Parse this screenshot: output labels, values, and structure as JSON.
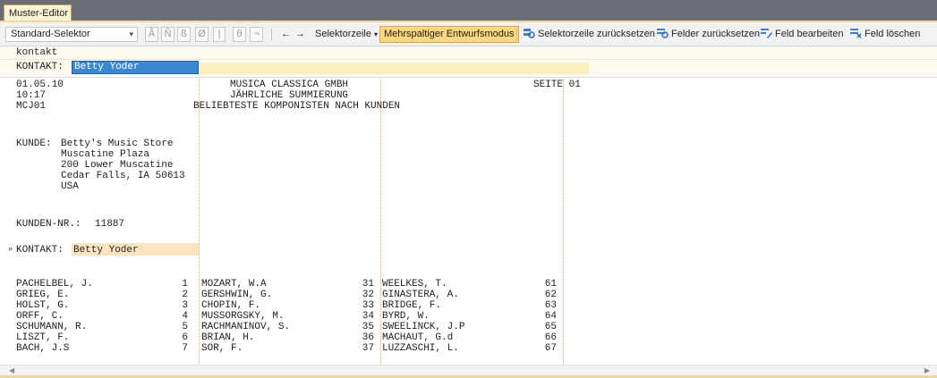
{
  "tab": {
    "title": "Muster-Editor"
  },
  "toolbar": {
    "selector": "Standard-Selektor",
    "glyphs": [
      "Ã",
      "Ñ",
      "ß",
      "Ø",
      "|",
      "θ",
      "¬"
    ],
    "arrow_left": "←",
    "arrow_right": "→",
    "selektorzeile_label": "Selektorzeile",
    "mehrspaltig_label": "Mehrspaltiger Entwurfsmodus",
    "reset_selektorzeile_label": "Selektorzeile zurücksetzen",
    "reset_felder_label": "Felder zurücksetzen",
    "edit_field_label": "Feld bearbeiten",
    "delete_field_label": "Feld löschen"
  },
  "selector_row": {
    "text": "kontakt"
  },
  "field_row": {
    "label": "KONTAKT:",
    "value": "Betty Yoder"
  },
  "document": {
    "header_left": [
      "01.05.10",
      "10:17",
      "MCJ01"
    ],
    "company": "MUSICA CLASSICA GMBH",
    "subtitle": "JÄHRLICHE SUMMIERUNG",
    "report_title": "BELIEBTESTE KOMPONISTEN NACH KUNDEN",
    "page_label": "SEITE 01",
    "customer_label": "KUNDE:",
    "customer_lines": [
      "Betty's Music Store",
      "Muscatine Plaza",
      "200 Lower Muscatine",
      "Cedar Falls, IA 50613",
      "USA"
    ],
    "customer_no_label": "KUNDEN-NR.:",
    "customer_no": "11887",
    "contact_label": "KONTAKT:",
    "contact_value": "Betty Yoder",
    "marker": "»",
    "composers": [
      {
        "c1": "PACHELBEL, J.",
        "n1": "1",
        "c2": "MOZART, W.A",
        "n2": "31",
        "c3": "WEELKES, T.",
        "n3": "61"
      },
      {
        "c1": "GRIEG, E.",
        "n1": "2",
        "c2": "GERSHWIN, G.",
        "n2": "32",
        "c3": "GINASTERA, A.",
        "n3": "62"
      },
      {
        "c1": "HOLST, G.",
        "n1": "3",
        "c2": "CHOPIN, F.",
        "n2": "33",
        "c3": "BRIDGE, F.",
        "n3": "63"
      },
      {
        "c1": "ORFF, C.",
        "n1": "4",
        "c2": "MUSSORGSKY, M.",
        "n2": "34",
        "c3": "BYRD, W.",
        "n3": "64"
      },
      {
        "c1": "SCHUMANN, R.",
        "n1": "5",
        "c2": "RACHMANINOV, S.",
        "n2": "35",
        "c3": "SWEELINCK, J.P",
        "n3": "65"
      },
      {
        "c1": "LISZT, F.",
        "n1": "6",
        "c2": "BRIAN, H.",
        "n2": "36",
        "c3": "MACHAUT, G.d",
        "n3": "66"
      },
      {
        "c1": "BACH, J.S",
        "n1": "7",
        "c2": "SOR, F.",
        "n2": "37",
        "c3": "LUZZASCHI, L.",
        "n3": "67"
      }
    ]
  },
  "scrollbar": {
    "left": "◀",
    "right": "▶"
  }
}
